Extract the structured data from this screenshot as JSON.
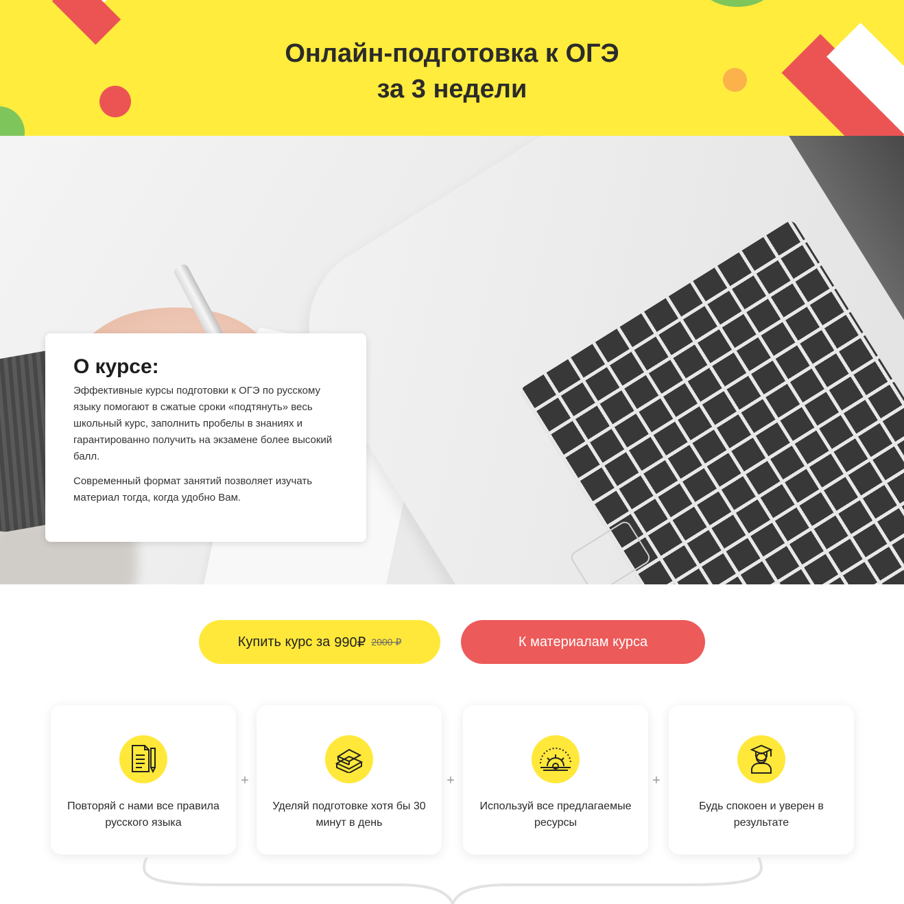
{
  "banner": {
    "title_line1": "Онлайн-подготовка к ОГЭ",
    "title_line2_prefix": "за",
    "title_line2_bold": "3 недели"
  },
  "about": {
    "title": "О курсе:",
    "paragraph1": "Эффективные курсы подготовки к ОГЭ по русскому языку помогают в сжатые сроки «подтянуть» весь школьный курс, заполнить пробелы в знаниях и гарантированно получить на экзамене более высокий балл.",
    "paragraph2": "Современный формат занятий позволяет изучать материал тогда, когда удобно Вам."
  },
  "buttons": {
    "buy_label": "Купить курс за",
    "buy_price": "990₽",
    "buy_old_price": "2000 ₽",
    "materials_label": "К материалам курса"
  },
  "features": [
    {
      "icon": "document-pencil-icon",
      "text": "Повторяй с нами все правила русского языка"
    },
    {
      "icon": "books-icon",
      "text": "Уделяй подготовке хотя бы 30 минут в день"
    },
    {
      "icon": "gear-resources-icon",
      "text": "Используй все предлагаемые ресурсы"
    },
    {
      "icon": "graduate-icon",
      "text": "Будь спокоен и уверен в результате"
    }
  ],
  "separators": [
    "+",
    "+",
    "+"
  ],
  "colors": {
    "banner_yellow": "#ffec3d",
    "accent_red": "#ec5a5a",
    "button_yellow": "#ffe83a",
    "accent_green": "#7ec55c",
    "accent_orange": "#fbb24b"
  }
}
